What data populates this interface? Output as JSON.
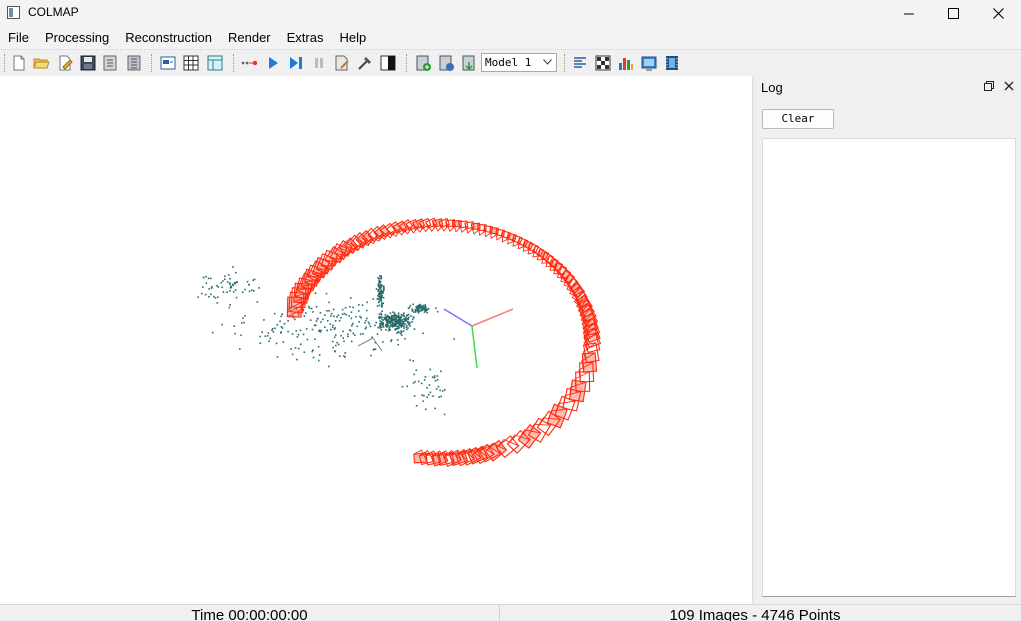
{
  "window": {
    "title": "COLMAP",
    "minimize_icon": "minimize-icon",
    "maximize_icon": "maximize-icon",
    "close_icon": "close-icon"
  },
  "menu": [
    "File",
    "Processing",
    "Reconstruction",
    "Render",
    "Extras",
    "Help"
  ],
  "toolbar": {
    "icons": [
      "new-project-icon",
      "open-project-icon",
      "edit-project-icon",
      "save-project-icon",
      "import-icon",
      "export-icon",
      "feature-extraction-icon",
      "feature-matching-icon",
      "database-icon",
      "automatic-reconstruction-icon",
      "start-reconstruction-icon",
      "step-reconstruction-icon",
      "pause-icon",
      "reconstruction-options-icon",
      "bundle-adjustment-icon",
      "color-render-icon",
      "reconstruction-stats-icon",
      "model-export-icon",
      "model-import-icon",
      "show-log-icon",
      "match-matrix-icon",
      "histogram-icon",
      "grab-image-icon",
      "grab-movie-icon"
    ],
    "model_select": "Model 1"
  },
  "viewport": {
    "content": "3d-reconstruction-view",
    "camera_color": "#ff2a10",
    "point_color": "#2a6b6b",
    "axis_colors": {
      "x": "#ff6666",
      "y": "#33cc33",
      "z": "#6666ff"
    }
  },
  "log_panel": {
    "title": "Log",
    "clear_label": "Clear",
    "content": ""
  },
  "status": {
    "time": "Time 00:00:00:00",
    "counts": "109 Images - 4746 Points"
  }
}
